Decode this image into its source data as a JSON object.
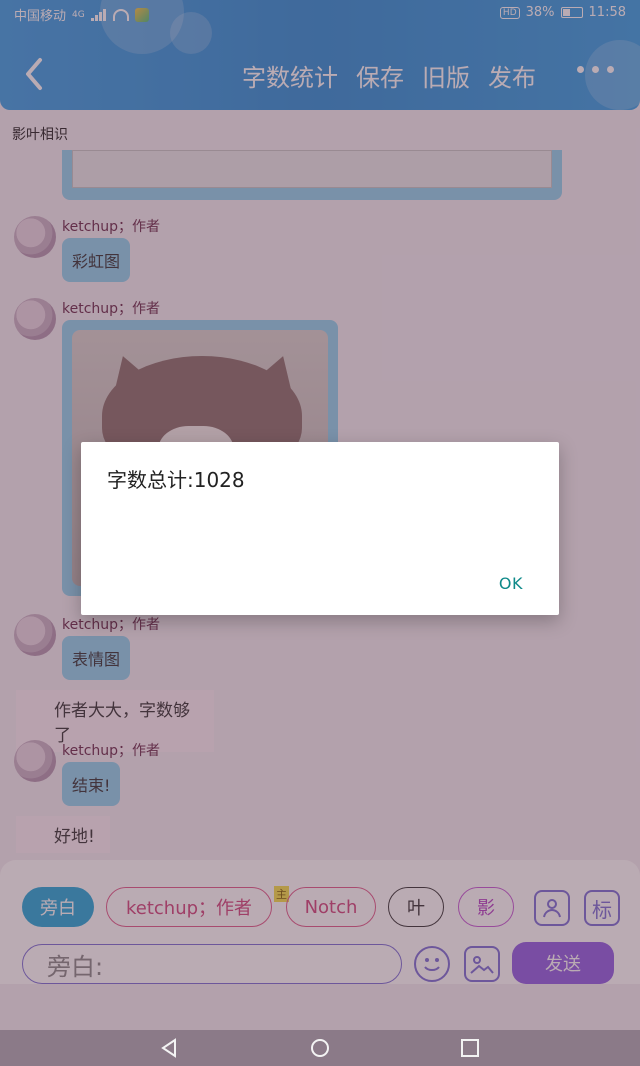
{
  "status_bar": {
    "carrier": "中国移动",
    "network": "4G",
    "battery": "38%",
    "time": "11:58"
  },
  "header": {
    "actions": [
      "字数统计",
      "保存",
      "旧版",
      "发布"
    ]
  },
  "page": {
    "title": "影叶相识"
  },
  "chat": {
    "messages": [
      {
        "author": "ketchup；作者",
        "text": "彩虹图"
      },
      {
        "author": "ketchup；作者"
      },
      {
        "author": "ketchup；作者",
        "text": "表情图"
      },
      {
        "narration": "作者大大，字数够了"
      },
      {
        "author": "ketchup；作者",
        "text": "结束!"
      },
      {
        "narration": "好地!"
      }
    ]
  },
  "composer": {
    "chips": [
      "旁白",
      "ketchup；作者",
      "Notch",
      "叶",
      "影"
    ],
    "main_marker": "主",
    "label_icon_text": "标",
    "input_value": "旁白:",
    "send_label": "发送"
  },
  "dialog": {
    "message": "字数总计:1028",
    "ok_label": "OK"
  }
}
